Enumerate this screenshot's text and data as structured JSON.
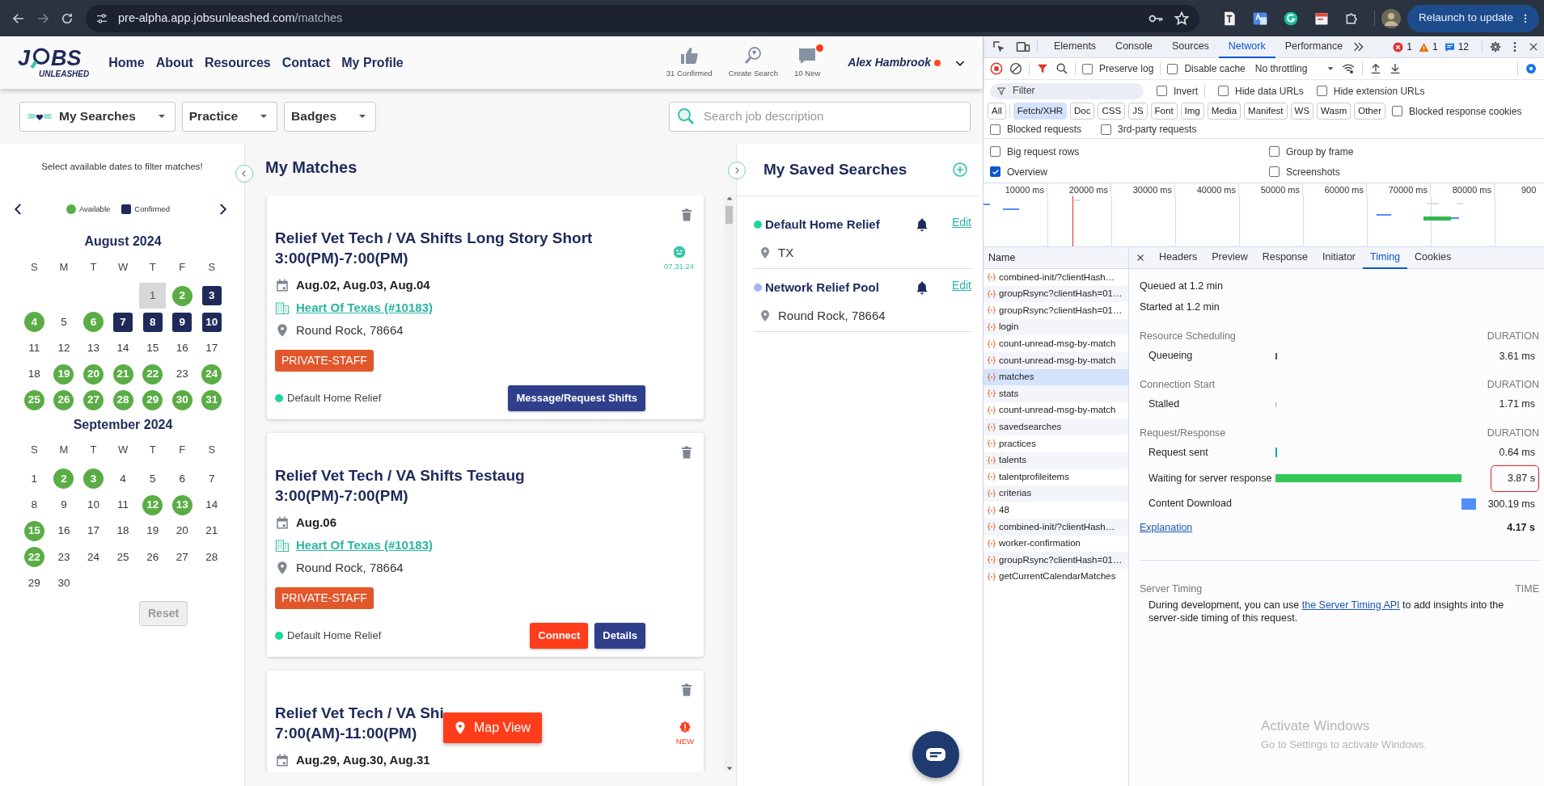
{
  "browser": {
    "url_host": "pre-alpha.app.jobsunleashed.com",
    "url_path": "/matches",
    "relaunch": "Relaunch to update"
  },
  "logo": {
    "before": "J",
    "after": "BS",
    "tagline": "UNLEASHED"
  },
  "nav": [
    {
      "label": "Home"
    },
    {
      "label": "About"
    },
    {
      "label": "Resources"
    },
    {
      "label": "Contact"
    },
    {
      "label": "My Profile"
    }
  ],
  "header_stats": [
    {
      "kind": "thumb",
      "label": "31 Confirmed",
      "alert": false
    },
    {
      "kind": "search",
      "label": "Create Search",
      "alert": false
    },
    {
      "kind": "chat",
      "label": "10 New",
      "alert": true
    }
  ],
  "user": {
    "name": "Alex Hambrook",
    "alert": true
  },
  "filters": [
    {
      "label": "My Searches",
      "kind": "searches"
    },
    {
      "label": "Practice",
      "kind": "plain"
    },
    {
      "label": "Badges",
      "kind": "plain"
    }
  ],
  "search": {
    "placeholder": "Search job description"
  },
  "calendar": {
    "hint": "Select available dates to filter matches!",
    "legend": [
      {
        "label": "Available",
        "kind": "available"
      },
      {
        "label": "Confirmed",
        "kind": "confirmed"
      }
    ],
    "months": [
      {
        "title": "August 2024",
        "weekdays": [
          "S",
          "M",
          "T",
          "W",
          "T",
          "F",
          "S"
        ],
        "weeks": [
          [
            {
              "day": "1",
              "kind": "today"
            },
            {
              "day": "2",
              "kind": "available"
            },
            {
              "day": "3",
              "kind": "confirmed"
            }
          ],
          [
            {
              "day": "4",
              "kind": "available"
            },
            {
              "day": "5",
              "kind": "plain"
            },
            {
              "day": "6",
              "kind": "available"
            },
            {
              "day": "7",
              "kind": "confirmed"
            },
            {
              "day": "8",
              "kind": "confirmed"
            },
            {
              "day": "9",
              "kind": "confirmed"
            },
            {
              "day": "10",
              "kind": "confirmed"
            }
          ],
          [
            {
              "day": "11",
              "kind": "plain"
            },
            {
              "day": "12",
              "kind": "plain"
            },
            {
              "day": "13",
              "kind": "plain"
            },
            {
              "day": "14",
              "kind": "plain"
            },
            {
              "day": "15",
              "kind": "plain"
            },
            {
              "day": "16",
              "kind": "plain"
            },
            {
              "day": "17",
              "kind": "plain"
            }
          ],
          [
            {
              "day": "18",
              "kind": "plain"
            },
            {
              "day": "19",
              "kind": "available"
            },
            {
              "day": "20",
              "kind": "available"
            },
            {
              "day": "21",
              "kind": "available"
            },
            {
              "day": "22",
              "kind": "available"
            },
            {
              "day": "23",
              "kind": "plain"
            },
            {
              "day": "24",
              "kind": "available"
            }
          ],
          [
            {
              "day": "25",
              "kind": "available"
            },
            {
              "day": "26",
              "kind": "available"
            },
            {
              "day": "27",
              "kind": "available"
            },
            {
              "day": "28",
              "kind": "available"
            },
            {
              "day": "29",
              "kind": "available"
            },
            {
              "day": "30",
              "kind": "available"
            },
            {
              "day": "31",
              "kind": "available"
            }
          ]
        ]
      },
      {
        "title": "September 2024",
        "weekdays": [
          "S",
          "M",
          "T",
          "W",
          "T",
          "F",
          "S"
        ],
        "weeks": [
          [
            {
              "day": "1",
              "kind": "plain"
            },
            {
              "day": "2",
              "kind": "available"
            },
            {
              "day": "3",
              "kind": "available"
            },
            {
              "day": "4",
              "kind": "plain"
            },
            {
              "day": "5",
              "kind": "plain"
            },
            {
              "day": "6",
              "kind": "plain"
            },
            {
              "day": "7",
              "kind": "plain"
            }
          ],
          [
            {
              "day": "8",
              "kind": "plain"
            },
            {
              "day": "9",
              "kind": "plain"
            },
            {
              "day": "10",
              "kind": "plain"
            },
            {
              "day": "11",
              "kind": "plain"
            },
            {
              "day": "12",
              "kind": "available"
            },
            {
              "day": "13",
              "kind": "available"
            },
            {
              "day": "14",
              "kind": "plain"
            }
          ],
          [
            {
              "day": "15",
              "kind": "available"
            },
            {
              "day": "16",
              "kind": "plain"
            },
            {
              "day": "17",
              "kind": "plain"
            },
            {
              "day": "18",
              "kind": "plain"
            },
            {
              "day": "19",
              "kind": "plain"
            },
            {
              "day": "20",
              "kind": "plain"
            },
            {
              "day": "21",
              "kind": "plain"
            }
          ],
          [
            {
              "day": "22",
              "kind": "available"
            },
            {
              "day": "23",
              "kind": "plain"
            },
            {
              "day": "24",
              "kind": "plain"
            },
            {
              "day": "25",
              "kind": "plain"
            },
            {
              "day": "26",
              "kind": "plain"
            },
            {
              "day": "27",
              "kind": "plain"
            },
            {
              "day": "28",
              "kind": "plain"
            }
          ],
          [
            {
              "day": "29",
              "kind": "plain"
            },
            {
              "day": "30",
              "kind": "plain"
            }
          ]
        ]
      }
    ],
    "reset": {
      "label": "Reset",
      "disabled": true
    }
  },
  "matches": {
    "title": "My Matches",
    "cards": [
      {
        "title": "Relief Vet Tech / VA Shifts Long Story Short",
        "time": "3:00(PM)-7:00(PM)",
        "dates": "Aug.02, Aug.03, Aug.04",
        "practice": "Heart Of Texas (#10183)",
        "location": "Round Rock, 78664",
        "tag": "PRIVATE-STAFF",
        "search": {
          "label": "Default Home Relief",
          "color": "#1fd69a"
        },
        "status": {
          "kind": "smile",
          "label": "07.31.24"
        },
        "buttons": [
          {
            "label": "Message/Request Shifts",
            "kind": "primary"
          }
        ]
      },
      {
        "title": "Relief Vet Tech / VA Shifts Testaug",
        "time": "3:00(PM)-7:00(PM)",
        "dates": "Aug.06",
        "practice": "Heart Of Texas (#10183)",
        "location": "Round Rock, 78664",
        "tag": "PRIVATE-STAFF",
        "search": {
          "label": "Default Home Relief",
          "color": "#1fd69a"
        },
        "buttons": [
          {
            "label": "Connect",
            "kind": "danger"
          },
          {
            "label": "Details",
            "kind": "primary"
          }
        ]
      },
      {
        "title": "Relief Vet Tech / VA Shi",
        "time": "7:00(AM)-11:00(PM)",
        "dates": "Aug.29, Aug.30, Aug.31",
        "status": {
          "kind": "alert",
          "label": "NEW"
        }
      }
    ]
  },
  "map_view": "Map View",
  "saved_searches": {
    "title": "My Saved Searches",
    "items": [
      {
        "name": "Default Home Relief",
        "color": "#1fd69a",
        "location": "TX",
        "edit": "Edit"
      },
      {
        "name": "Network Relief Pool",
        "color": "#a3b5f7",
        "location": "Round Rock, 78664",
        "edit": "Edit"
      }
    ]
  },
  "devtools": {
    "tabs": [
      {
        "label": "Elements",
        "selected": false
      },
      {
        "label": "Console",
        "selected": false
      },
      {
        "label": "Sources",
        "selected": false
      },
      {
        "label": "Network",
        "selected": true
      },
      {
        "label": "Performance",
        "selected": false
      }
    ],
    "errors": "1",
    "warnings": "1",
    "messages": "12",
    "toolbar": {
      "checkboxes": [
        {
          "label": "Preserve log",
          "checked": false
        },
        {
          "label": "Disable cache",
          "checked": false
        }
      ],
      "throttling": "No throttling"
    },
    "filter": {
      "placeholder": "Filter",
      "checkboxes": [
        {
          "label": "Invert",
          "checked": false
        },
        {
          "label": "Hide data URLs",
          "checked": false
        },
        {
          "label": "Hide extension URLs",
          "checked": false
        }
      ]
    },
    "types": [
      {
        "label": "All",
        "selected": false
      },
      {
        "label": "Fetch/XHR",
        "selected": true
      },
      {
        "label": "Doc",
        "selected": false
      },
      {
        "label": "CSS",
        "selected": false
      },
      {
        "label": "JS",
        "selected": false
      },
      {
        "label": "Font",
        "selected": false
      },
      {
        "label": "Img",
        "selected": false
      },
      {
        "label": "Media",
        "selected": false
      },
      {
        "label": "Manifest",
        "selected": false
      },
      {
        "label": "WS",
        "selected": false
      },
      {
        "label": "Wasm",
        "selected": false
      },
      {
        "label": "Other",
        "selected": false
      }
    ],
    "type_checkbox": {
      "label": "Blocked response cookies",
      "checked": false
    },
    "blocked": [
      {
        "label": "Blocked requests",
        "checked": false
      },
      {
        "label": "3rd-party requests",
        "checked": false
      }
    ],
    "options": [
      {
        "label": "Big request rows",
        "checked": false
      },
      {
        "label": "Group by frame",
        "checked": false
      },
      {
        "label": "Overview",
        "checked": true
      },
      {
        "label": "Screenshots",
        "checked": false
      }
    ],
    "timeline_ticks": [
      "10000 ms",
      "20000 ms",
      "30000 ms",
      "40000 ms",
      "50000 ms",
      "60000 ms",
      "70000 ms",
      "80000 ms",
      "900"
    ],
    "name_header": "Name",
    "requests": [
      {
        "name": "combined-init/?clientHash…",
        "selected": false
      },
      {
        "name": "groupRsync?clientHash=01…",
        "selected": false
      },
      {
        "name": "groupRsync?clientHash=01…",
        "selected": false
      },
      {
        "name": "login",
        "selected": false
      },
      {
        "name": "count-unread-msg-by-match",
        "selected": false
      },
      {
        "name": "count-unread-msg-by-match",
        "selected": false
      },
      {
        "name": "matches",
        "selected": true
      },
      {
        "name": "stats",
        "selected": false
      },
      {
        "name": "count-unread-msg-by-match",
        "selected": false
      },
      {
        "name": "savedsearches",
        "selected": false
      },
      {
        "name": "practices",
        "selected": false
      },
      {
        "name": "talents",
        "selected": false
      },
      {
        "name": "talentprofileitems",
        "selected": false
      },
      {
        "name": "criterias",
        "selected": false
      },
      {
        "name": "48",
        "selected": false
      },
      {
        "name": "combined-init/?clientHash…",
        "selected": false
      },
      {
        "name": "worker-confirmation",
        "selected": false
      },
      {
        "name": "groupRsync?clientHash=01…",
        "selected": false
      },
      {
        "name": "getCurrentCalendarMatches",
        "selected": false
      }
    ],
    "detail_tabs": [
      {
        "label": "Headers",
        "selected": false
      },
      {
        "label": "Preview",
        "selected": false
      },
      {
        "label": "Response",
        "selected": false
      },
      {
        "label": "Initiator",
        "selected": false
      },
      {
        "label": "Timing",
        "selected": true
      },
      {
        "label": "Cookies",
        "selected": false
      }
    ],
    "timing": {
      "queued": "Queued at 1.2 min",
      "started": "Started at 1.2 min",
      "sections": [
        {
          "title": "Resource Scheduling",
          "heading": "DURATION",
          "rows": [
            {
              "kind": "queueing",
              "label": "Queueing",
              "value": "3.61 ms",
              "highlighted": false
            }
          ]
        },
        {
          "title": "Connection Start",
          "heading": "DURATION",
          "rows": [
            {
              "kind": "stalled",
              "label": "Stalled",
              "value": "1.71 ms",
              "highlighted": false
            }
          ]
        },
        {
          "title": "Request/Response",
          "heading": "DURATION",
          "rows": [
            {
              "kind": "sent",
              "label": "Request sent",
              "value": "0.64 ms",
              "highlighted": false
            },
            {
              "kind": "waiting",
              "label": "Waiting for server response",
              "value": "3.87 s",
              "highlighted": true
            },
            {
              "kind": "download",
              "label": "Content Download",
              "value": "300.19 ms",
              "highlighted": false
            }
          ]
        }
      ],
      "explanation": "Explanation",
      "total": "4.17 s"
    },
    "server_timing": {
      "title": "Server Timing",
      "heading": "TIME",
      "text_before": "During development, you can use ",
      "link": "the Server Timing API",
      "text_after": " to add insights into the server-side timing of this request."
    }
  },
  "os_notice": {
    "title": "Activate Windows",
    "text": "Go to Settings to activate Windows."
  }
}
